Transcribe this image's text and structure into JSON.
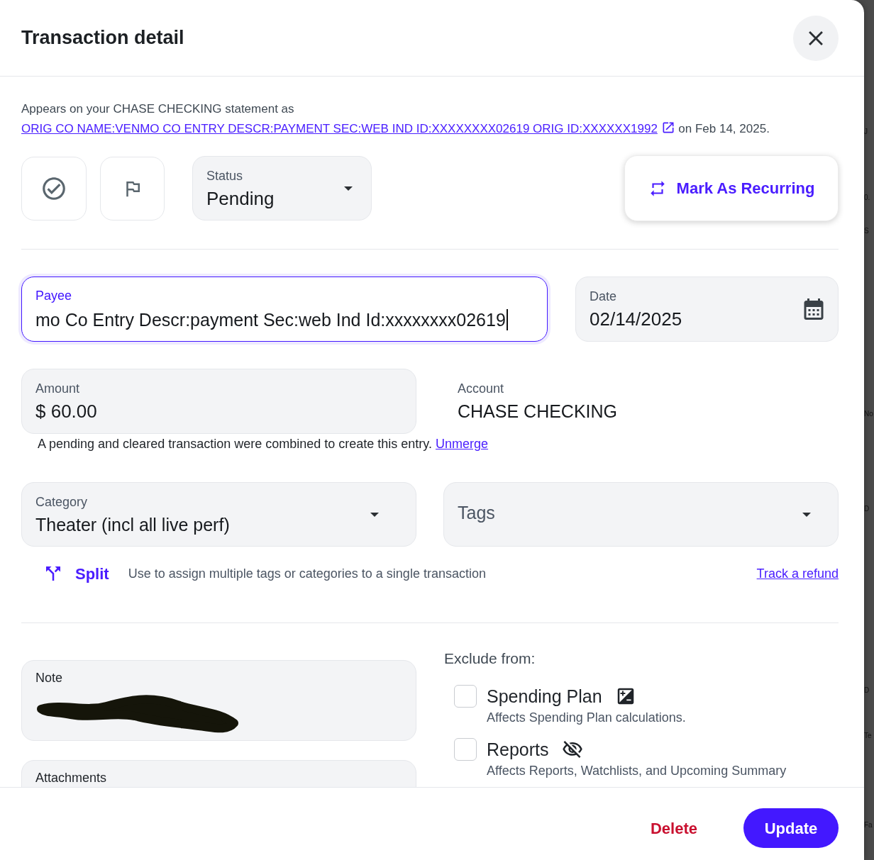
{
  "dialog": {
    "title": "Transaction detail"
  },
  "statement": {
    "prefix": "Appears on your CHASE CHECKING statement as",
    "link": "ORIG CO NAME:VENMO CO ENTRY DESCR:PAYMENT SEC:WEB IND ID:XXXXXXXX02619 ORIG ID:XXXXXX1992",
    "suffix": "on Feb 14, 2025."
  },
  "status": {
    "label": "Status",
    "value": "Pending"
  },
  "recurring_button": {
    "label": "Mark As Recurring"
  },
  "payee": {
    "label": "Payee",
    "value": "mo Co Entry Descr:payment Sec:web Ind Id:xxxxxxxx02619",
    "focused": true
  },
  "date": {
    "label": "Date",
    "value": "02/14/2025"
  },
  "amount": {
    "label": "Amount",
    "value": "$ 60.00"
  },
  "account": {
    "label": "Account",
    "value": "CHASE CHECKING"
  },
  "merge_note": {
    "text": "A pending and cleared transaction were combined to create this entry.",
    "link": "Unmerge"
  },
  "category": {
    "label": "Category",
    "value": "Theater (incl all live perf)"
  },
  "tags": {
    "placeholder": "Tags"
  },
  "split": {
    "label": "Split",
    "description": "Use to assign multiple tags or categories to a single transaction",
    "refund_link": "Track a refund"
  },
  "note": {
    "label": "Note",
    "redacted": true
  },
  "attachments": {
    "label": "Attachments"
  },
  "exclude": {
    "heading": "Exclude from:",
    "options": [
      {
        "kind": "spending_plan",
        "label": "Spending Plan",
        "checked": false,
        "description": "Affects Spending Plan calculations."
      },
      {
        "kind": "reports",
        "label": "Reports",
        "checked": false,
        "description": "Affects Reports, Watchlists, and Upcoming Summary"
      }
    ]
  },
  "footer": {
    "buttons": [
      {
        "kind": "danger",
        "label": "Delete"
      },
      {
        "kind": "primary",
        "label": "Update"
      }
    ]
  },
  "background_page": {
    "fragments": [
      "J",
      "0.",
      "S",
      "No",
      "D",
      "D",
      "Te",
      "Fa"
    ]
  }
}
